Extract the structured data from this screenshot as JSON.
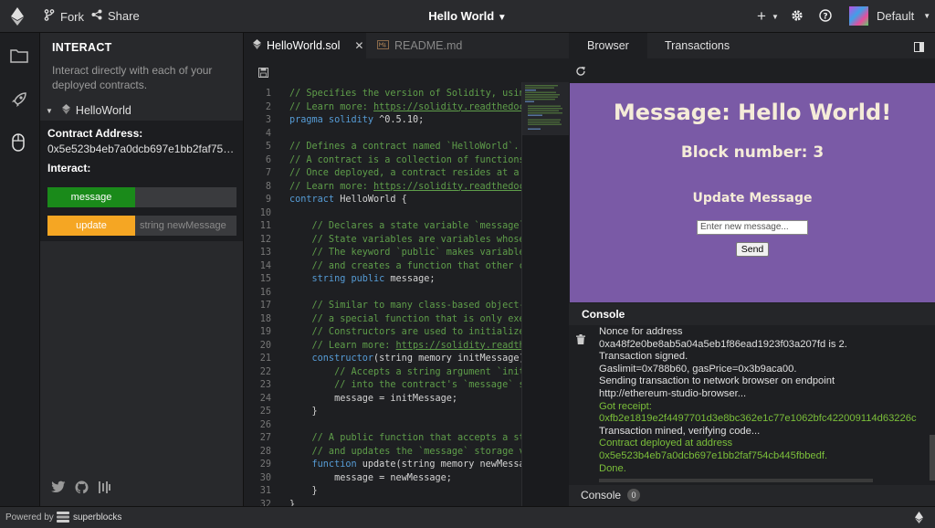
{
  "topbar": {
    "fork_label": "Fork",
    "share_label": "Share",
    "project_title": "Hello World",
    "add_label": "+",
    "account_label": "Default"
  },
  "interact": {
    "title": "INTERACT",
    "description": "Interact directly with each of your deployed contracts.",
    "contract_name": "HelloWorld",
    "address_label": "Contract Address:",
    "address_value": "0x5e523b4eb7a0dcb697e1bb2faf754cb445fbbedf",
    "interact_label": "Interact:",
    "functions": [
      {
        "name": "message",
        "color": "#1a8a1a",
        "input_placeholder": ""
      },
      {
        "name": "update",
        "color": "#f5a623",
        "input_placeholder": "string newMessage"
      }
    ]
  },
  "editor": {
    "tabs": [
      {
        "label": "HelloWorld.sol",
        "active": true
      },
      {
        "label": "README.md",
        "active": false
      }
    ],
    "lines": [
      {
        "n": "1",
        "segs": [
          {
            "t": "// Specifies the version of Solidity, using",
            "c": "com"
          }
        ]
      },
      {
        "n": "2",
        "segs": [
          {
            "t": "// Learn more: ",
            "c": "com"
          },
          {
            "t": "https://solidity.readthedocs.",
            "c": "link"
          }
        ]
      },
      {
        "n": "3",
        "segs": [
          {
            "t": "pragma solidity",
            "c": "kw"
          },
          {
            "t": " ^0.5.10;",
            "c": "plain"
          }
        ]
      },
      {
        "n": "4",
        "segs": []
      },
      {
        "n": "5",
        "segs": [
          {
            "t": "// Defines a contract named `HelloWorld`.",
            "c": "com"
          }
        ]
      },
      {
        "n": "6",
        "segs": [
          {
            "t": "// A contract is a collection of functions a",
            "c": "com"
          }
        ]
      },
      {
        "n": "7",
        "segs": [
          {
            "t": "// Once deployed, a contract resides at a sp",
            "c": "com"
          }
        ]
      },
      {
        "n": "8",
        "segs": [
          {
            "t": "// Learn more: ",
            "c": "com"
          },
          {
            "t": "https://solidity.readthedocs.",
            "c": "link"
          }
        ]
      },
      {
        "n": "9",
        "segs": [
          {
            "t": "contract",
            "c": "kw"
          },
          {
            "t": " HelloWorld {",
            "c": "plain"
          }
        ]
      },
      {
        "n": "10",
        "segs": []
      },
      {
        "n": "11",
        "segs": [
          {
            "t": "    // Declares a state variable `message` o",
            "c": "com"
          }
        ]
      },
      {
        "n": "12",
        "segs": [
          {
            "t": "    // State variables are variables whose v",
            "c": "com"
          }
        ]
      },
      {
        "n": "13",
        "segs": [
          {
            "t": "    // The keyword `public` makes variables",
            "c": "com"
          }
        ]
      },
      {
        "n": "14",
        "segs": [
          {
            "t": "    // and creates a function that other con",
            "c": "com"
          }
        ]
      },
      {
        "n": "15",
        "segs": [
          {
            "t": "    string public",
            "c": "kw"
          },
          {
            "t": " message;",
            "c": "plain"
          }
        ]
      },
      {
        "n": "16",
        "segs": []
      },
      {
        "n": "17",
        "segs": [
          {
            "t": "    // Similar to many class-based object-or",
            "c": "com"
          }
        ]
      },
      {
        "n": "18",
        "segs": [
          {
            "t": "    // a special function that is only execu",
            "c": "com"
          }
        ]
      },
      {
        "n": "19",
        "segs": [
          {
            "t": "    // Constructors are used to initialize t",
            "c": "com"
          }
        ]
      },
      {
        "n": "20",
        "segs": [
          {
            "t": "    // Learn more: ",
            "c": "com"
          },
          {
            "t": "https://solidity.readthec",
            "c": "link"
          }
        ]
      },
      {
        "n": "21",
        "segs": [
          {
            "t": "    constructor",
            "c": "kw"
          },
          {
            "t": "(string memory initMessage) p",
            "c": "plain"
          }
        ]
      },
      {
        "n": "22",
        "segs": [
          {
            "t": "        // Accepts a string argument `initMe",
            "c": "com"
          }
        ]
      },
      {
        "n": "23",
        "segs": [
          {
            "t": "        // into the contract's `message` sto",
            "c": "com"
          }
        ]
      },
      {
        "n": "24",
        "segs": [
          {
            "t": "        message = initMessage;",
            "c": "plain"
          }
        ]
      },
      {
        "n": "25",
        "segs": [
          {
            "t": "    }",
            "c": "plain"
          }
        ]
      },
      {
        "n": "26",
        "segs": []
      },
      {
        "n": "27",
        "segs": [
          {
            "t": "    // A public function that accepts a stri",
            "c": "com"
          }
        ]
      },
      {
        "n": "28",
        "segs": [
          {
            "t": "    // and updates the `message` storage var",
            "c": "com"
          }
        ]
      },
      {
        "n": "29",
        "segs": [
          {
            "t": "    function",
            "c": "kw"
          },
          {
            "t": " update(string memory newMessage",
            "c": "plain"
          }
        ]
      },
      {
        "n": "30",
        "segs": [
          {
            "t": "        message = newMessage;",
            "c": "plain"
          }
        ]
      },
      {
        "n": "31",
        "segs": [
          {
            "t": "    }",
            "c": "plain"
          }
        ]
      },
      {
        "n": "32",
        "segs": [
          {
            "t": "}",
            "c": "plain"
          }
        ]
      }
    ]
  },
  "right": {
    "tabs": [
      "Browser",
      "Transactions"
    ],
    "browser": {
      "heading": "Message: Hello World!",
      "block": "Block number: 3",
      "update_heading": "Update Message",
      "input_placeholder": "Enter new message...",
      "send_label": "Send",
      "bg_color": "#7a5aa6"
    },
    "console_title": "Console",
    "console_lines": [
      {
        "t": "Nonce for address",
        "c": "w"
      },
      {
        "t": "0xa48f2e0be8ab5a04a5eb1f86ead1923f03a207fd is 2.",
        "c": "w"
      },
      {
        "t": "Transaction signed.",
        "c": "w"
      },
      {
        "t": "Gaslimit=0x788b60, gasPrice=0x3b9aca00.",
        "c": "w"
      },
      {
        "t": "Sending transaction to network browser on endpoint",
        "c": "w"
      },
      {
        "t": "http://ethereum-studio-browser...",
        "c": "w"
      },
      {
        "t": "Got receipt:",
        "c": "g"
      },
      {
        "t": "0xfb2e1819e2f4497701d3e8bc362e1c77e1062bfc422009114d63226c",
        "c": "g"
      },
      {
        "t": "Transaction mined, verifying code...",
        "c": "w"
      },
      {
        "t": "Contract deployed at address",
        "c": "g"
      },
      {
        "t": "0x5e523b4eb7a0dcb697e1bb2faf754cb445fbbedf.",
        "c": "g"
      },
      {
        "t": "Done.",
        "c": "g"
      }
    ],
    "console_footer_label": "Console",
    "console_footer_count": "0"
  },
  "footer": {
    "powered_by": "Powered by",
    "brand": "superblocks"
  }
}
